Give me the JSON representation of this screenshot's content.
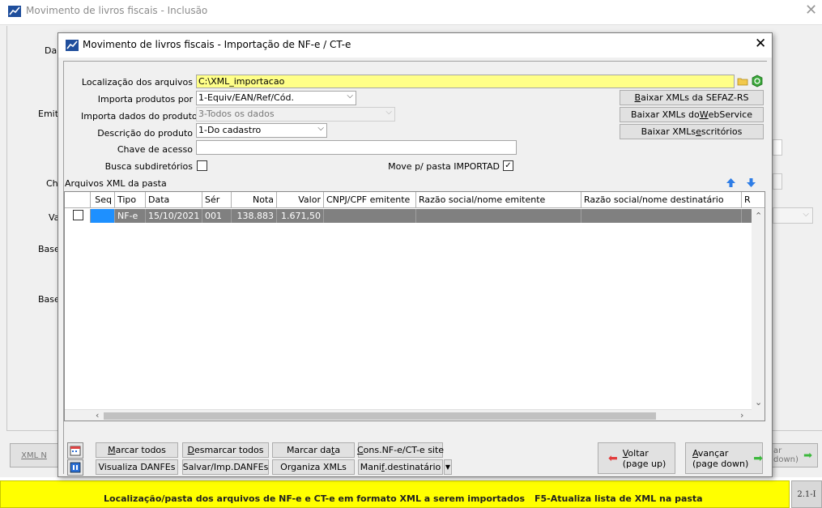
{
  "background_window": {
    "title": "Movimento de livros fiscais - Inclusão",
    "labels": [
      "Da",
      "Emite",
      "Ch",
      "Va",
      "Base",
      "Base"
    ],
    "bottom_left_button": "XML N",
    "bottom_right_button_line1": "ar",
    "bottom_right_button_line2": "down)"
  },
  "dialog": {
    "title": "Movimento de livros fiscais - Importação de NF-e / CT-e",
    "close_glyph": "✕",
    "form": {
      "localizacao_label": "Localização dos arquivos",
      "localizacao_value": "C:\\XML_importacao",
      "importa_produtos_label": "Importa produtos por",
      "importa_produtos_value": "1-Equiv/EAN/Ref/Cód.",
      "importa_dados_label": "Importa dados do produto",
      "importa_dados_value": "3-Todos os dados",
      "descricao_label": "Descrição do produto",
      "descricao_value": "1-Do cadastro",
      "chave_label": "Chave de acesso",
      "chave_value": "",
      "busca_label": "Busca subdiretórios",
      "busca_checked": false,
      "move_label": "Move p/ pasta IMPORTAD",
      "move_checked": true,
      "arquivos_label": "Arquivos XML da pasta"
    },
    "side_buttons": {
      "sefaz_prefix": "",
      "sefaz_u": "B",
      "sefaz_rest": "aixar XMLs da SEFAZ-RS",
      "webservice_prefix": "Baixar XMLs do ",
      "webservice_u": "W",
      "webservice_rest": "ebService",
      "escritorios_prefix": "Baixar XMLs ",
      "escritorios_u": "e",
      "escritorios_rest": "scritórios"
    },
    "table": {
      "columns": [
        "",
        "Seq",
        "Tipo",
        "Data",
        "Sér",
        "Nota",
        "Valor",
        "CNPJ/CPF emitente",
        "Razão social/nome emitente",
        "Razão social/nome destinatário",
        "R"
      ],
      "rows": [
        {
          "checked": false,
          "seq": "",
          "tipo": "NF-e",
          "data": "15/10/2021",
          "serie": "001",
          "nota": "138.883",
          "valor": "1.671,50",
          "cnpj": "",
          "emitente": "",
          "destinatario": ""
        }
      ]
    },
    "bottom_buttons": {
      "marcar_todos_u": "M",
      "marcar_todos_rest": "arcar todos",
      "desmarcar_u": "D",
      "desmarcar_rest": "esmarcar todos",
      "marcar_data_prefix": "Marcar da",
      "marcar_data_u": "t",
      "marcar_data_rest": "a",
      "cons_u": "C",
      "cons_rest": "ons.NF-e/CT-e site",
      "visualiza": "Visualiza DANFEs",
      "salvar": "Salvar/Imp.DANFEs",
      "organiza": "Organiza XMLs",
      "manif_prefix": "Mani",
      "manif_u": "f",
      "manif_rest": ".destinatário",
      "voltar_u": "V",
      "voltar_rest": "oltar",
      "voltar_line2": "(page up)",
      "avancar_u": "A",
      "avancar_rest": "vançar",
      "avancar_line2": "(page down)"
    }
  },
  "status": {
    "left": "Localização/pasta dos arquivos de NF-e e CT-e em formato XML a serem importados",
    "right": "F5-Atualiza lista de XML na pasta",
    "version": "2.1-I"
  },
  "colors": {
    "status_bar": "#ffff00",
    "selected_row": "#808080",
    "seq_cell": "#1e90ff",
    "path_field": "#ffff88"
  }
}
